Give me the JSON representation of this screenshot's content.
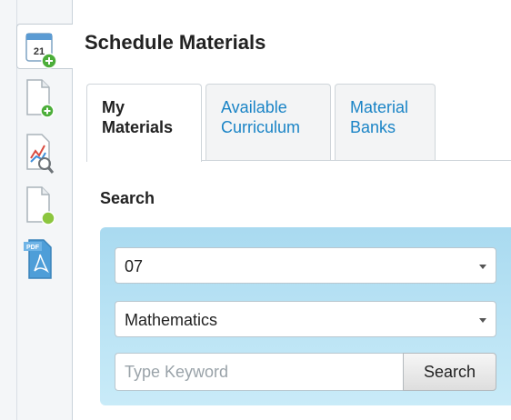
{
  "page": {
    "title": "Schedule Materials"
  },
  "rail": {
    "items": [
      {
        "icon": "calendar-add-icon",
        "calendar_day": "21"
      },
      {
        "icon": "document-add-icon"
      },
      {
        "icon": "document-search-icon"
      },
      {
        "icon": "document-status-icon"
      },
      {
        "icon": "pdf-icon",
        "badge": "PDF"
      }
    ]
  },
  "tabs": [
    {
      "line1": "My",
      "line2": "Materials"
    },
    {
      "line1": "Available",
      "line2": "Curriculum"
    },
    {
      "line1": "Material",
      "line2": "Banks"
    }
  ],
  "search": {
    "label": "Search",
    "grade_value": "07",
    "subject_value": "Mathematics",
    "keyword_placeholder": "Type Keyword",
    "button_label": "Search"
  },
  "colors": {
    "tab_link": "#1a84c6",
    "panel": "#b9e2f3",
    "accent_green": "#4cae3a"
  }
}
